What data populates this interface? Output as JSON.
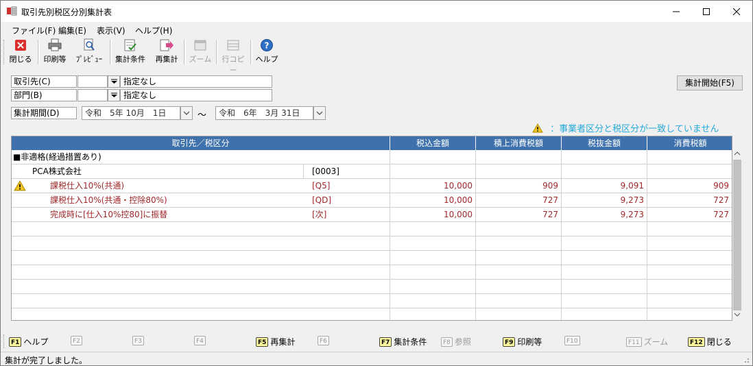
{
  "window": {
    "title": "取引先別税区分別集計表"
  },
  "menu": [
    "ファイル(F)",
    "編集(E)",
    "表示(V)",
    "ヘルプ(H)"
  ],
  "toolbar": {
    "close": "閉じる",
    "print": "印刷等",
    "preview": "ﾌﾟﾚﾋﾞｭｰ",
    "conditions": "集計条件",
    "recalc": "再集計",
    "zoom": "ズーム",
    "rowcopy": "行コピー",
    "help": "ヘルプ"
  },
  "conditions": {
    "partner_label": "取引先(C)",
    "partner_code": "",
    "partner_value": "指定なし",
    "dept_label": "部門(B)",
    "dept_code": "",
    "dept_value": "指定なし",
    "period_label": "集計期間(D)",
    "period_from": "令和　5年 10月　1日",
    "period_sep": "〜",
    "period_to": "令和　6年　3月 31日"
  },
  "start_button": "集計開始(F5)",
  "warning_message": "：事業者区分と税区分が一致していません",
  "table": {
    "headers": [
      "取引先／税区分",
      "税込金額",
      "積上消費税額",
      "税抜金額",
      "消費税額"
    ],
    "rows": [
      {
        "name": "■非適格(経過措置あり)",
        "code": "",
        "incl": "",
        "stack_tax": "",
        "excl": "",
        "tax": ""
      },
      {
        "name": "PCA株式会社",
        "code": "[0003]",
        "incl": "",
        "stack_tax": "",
        "excl": "",
        "tax": ""
      },
      {
        "name": "課税仕入10%(共通)",
        "code": "[Q5]",
        "incl": "10,000",
        "stack_tax": "909",
        "excl": "9,091",
        "tax": "909"
      },
      {
        "name": "課税仕入10%(共通・控除80%)",
        "code": "[QD]",
        "incl": "10,000",
        "stack_tax": "727",
        "excl": "9,273",
        "tax": "727"
      },
      {
        "name": "完成時に[仕入10%控80]に振替",
        "code": "[次]",
        "incl": "10,000",
        "stack_tax": "727",
        "excl": "9,273",
        "tax": "727"
      }
    ]
  },
  "fkeys": [
    {
      "key": "F1",
      "label": "ヘルプ"
    },
    {
      "key": "F2",
      "label": ""
    },
    {
      "key": "F3",
      "label": ""
    },
    {
      "key": "F4",
      "label": ""
    },
    {
      "key": "F5",
      "label": "再集計"
    },
    {
      "key": "F6",
      "label": ""
    },
    {
      "key": "F7",
      "label": "集計条件"
    },
    {
      "key": "F8",
      "label": "参照"
    },
    {
      "key": "F9",
      "label": "印刷等"
    },
    {
      "key": "F10",
      "label": ""
    },
    {
      "key": "F11",
      "label": "ズーム"
    },
    {
      "key": "F12",
      "label": "閉じる"
    }
  ],
  "status": "集計が完了しました。"
}
